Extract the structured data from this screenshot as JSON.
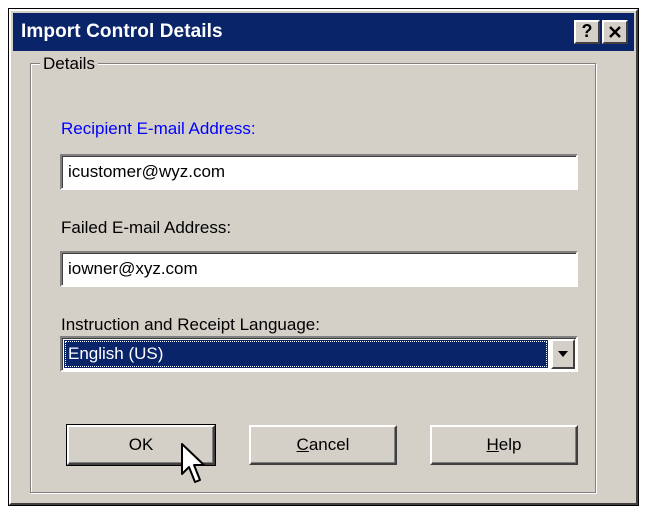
{
  "window": {
    "title": "Import Control Details",
    "help_button": "?",
    "close_button": "✕"
  },
  "group": {
    "legend": "Details"
  },
  "recipient": {
    "label": "Recipient E-mail Address:",
    "value": "icustomer@wyz.com"
  },
  "failed": {
    "label": "Failed E-mail Address:",
    "value": "iowner@xyz.com"
  },
  "language": {
    "label": "Instruction and Receipt Language:",
    "selected": "English (US)"
  },
  "buttons": {
    "ok": "OK",
    "cancel_first": "C",
    "cancel_rest": "ancel",
    "help_first": "H",
    "help_rest": "elp"
  },
  "colors": {
    "title_bar": "#0a246a",
    "face": "#d4d0c8",
    "label_highlight": "#0000ff"
  },
  "icons": {
    "cursor": "arrow-pointer-icon",
    "dropdown": "chevron-down-icon"
  }
}
